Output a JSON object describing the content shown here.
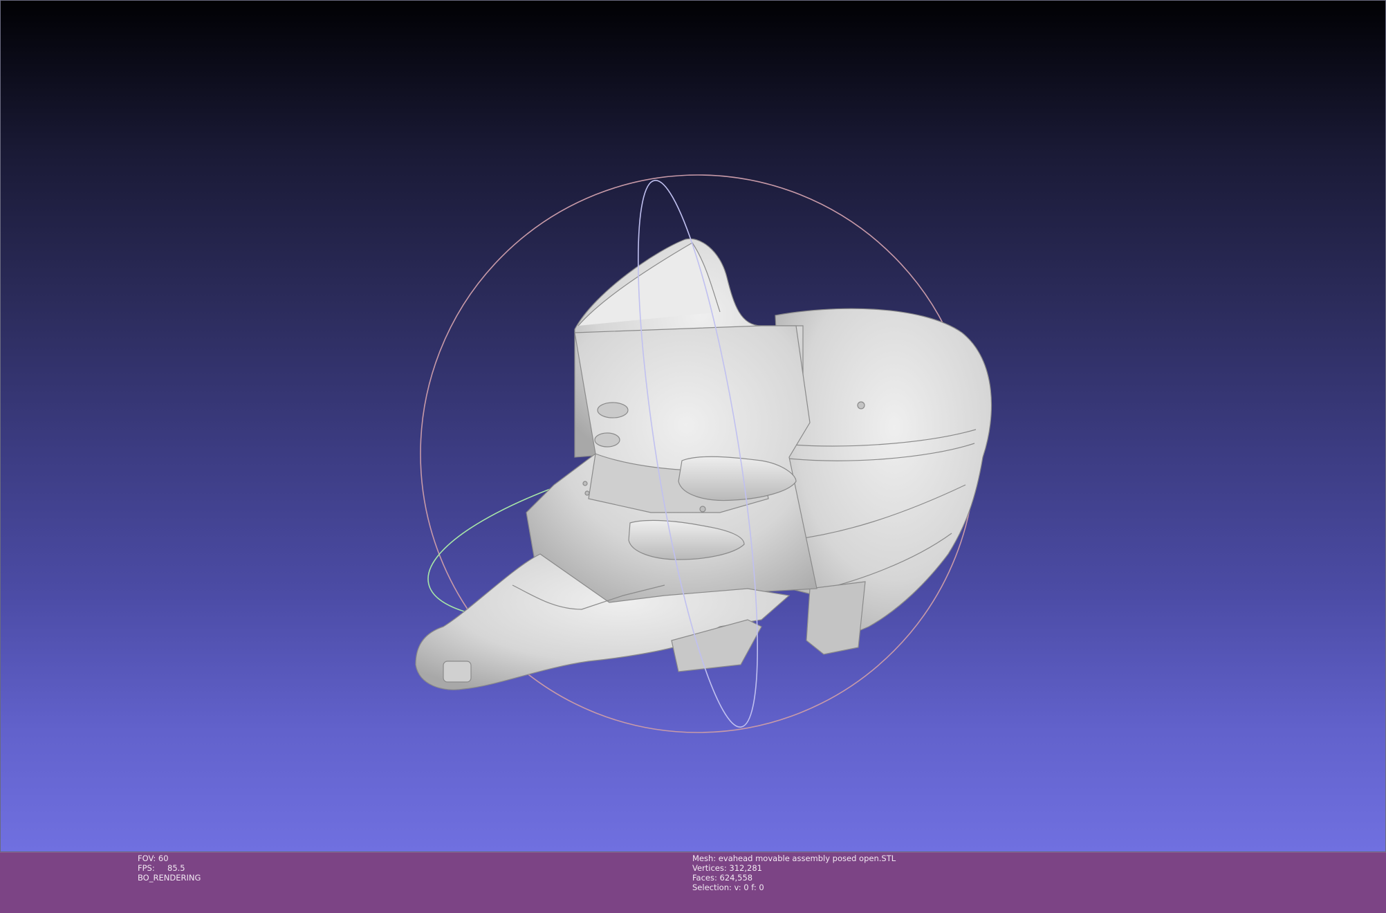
{
  "viewport": {
    "background_top": "#010104",
    "background_bottom": "#7070e0",
    "model_color": "#d9d9d9",
    "trackball_colors": {
      "x_ring": "#c89aa8",
      "y_ring": "#c0c0f0",
      "z_ring": "#a8e8a8"
    }
  },
  "status_left": {
    "fov": "FOV: 60",
    "fps": "FPS:     85.5",
    "mode": "BO_RENDERING"
  },
  "status_right": {
    "mesh": "Mesh: evahead movable assembly posed open.STL",
    "vertices": "Vertices: 312,281",
    "faces": "Faces: 624,558",
    "selection": "Selection: v: 0 f: 0"
  },
  "statusbar_color": "#7c4485"
}
